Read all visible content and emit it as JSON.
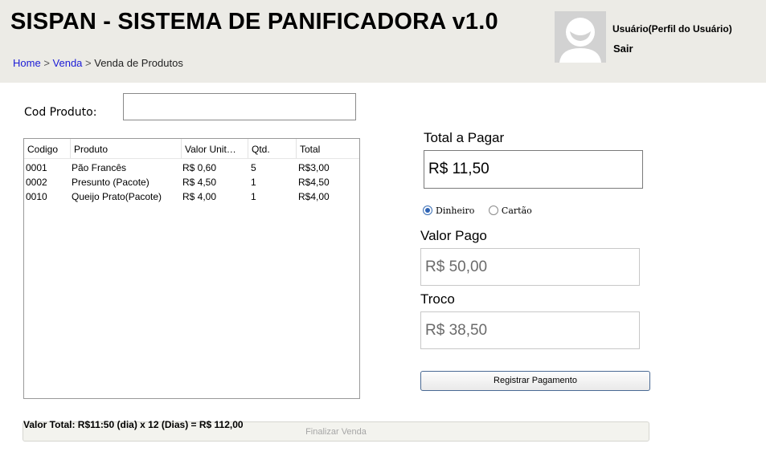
{
  "header": {
    "title": "SISPAN - SISTEMA DE PANIFICADORA v1.0",
    "breadcrumb": {
      "home": "Home",
      "sep1": ">",
      "venda": "Venda",
      "sep2": ">",
      "current": "Venda de Produtos"
    },
    "user": {
      "name": "Usuário(Perfil do Usuário)",
      "logout": "Sair",
      "avatar_icon": "user-avatar-icon"
    }
  },
  "product_entry": {
    "label": "Cod Produto:",
    "value": "",
    "placeholder": ""
  },
  "items_table": {
    "columns": [
      "Codigo",
      "Produto",
      "Valor Unit…",
      "Qtd.",
      "Total"
    ],
    "rows": [
      {
        "codigo": "0001",
        "produto": "Pão Francês",
        "valor_unit": "R$ 0,60",
        "qtd": "5",
        "total": "R$3,00"
      },
      {
        "codigo": "0002",
        "produto": "Presunto (Pacote)",
        "valor_unit": "R$ 4,50",
        "qtd": "1",
        "total": "R$4,50"
      },
      {
        "codigo": "0010",
        "produto": "Queijo Prato(Pacote)",
        "valor_unit": "R$ 4,00",
        "qtd": "1",
        "total": "R$4,00"
      }
    ]
  },
  "payment": {
    "total_label": "Total a Pagar",
    "total_value": "R$ 11,50",
    "methods": [
      {
        "label": "Dinheiro",
        "selected": true
      },
      {
        "label": "Cartão",
        "selected": false
      }
    ],
    "paid_label": "Valor Pago",
    "paid_value": "R$ 50,00",
    "change_label": "Troco",
    "change_value": "R$ 38,50",
    "register_button": "Registrar Pagamento"
  },
  "footer": {
    "total_text": "Valor Total: R$11:50 (dia) x 12 (Dias) =  R$ 112,00",
    "finalize_button": "Finalizar Venda"
  },
  "colors": {
    "header_bg": "#ecebe6",
    "link": "#1a1ad6",
    "radio_selected": "#2f64b5",
    "button_border": "#4a6a94"
  }
}
